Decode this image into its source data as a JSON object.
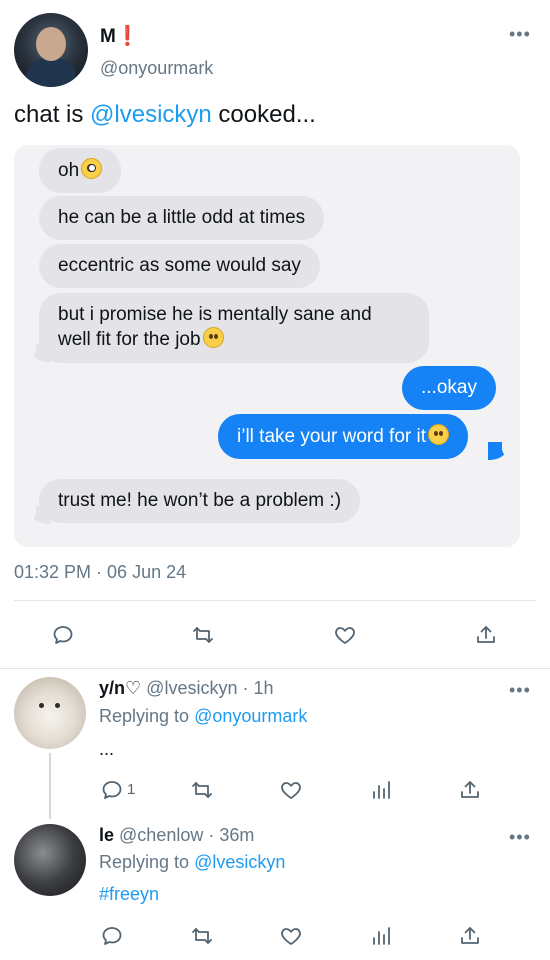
{
  "tweet": {
    "display_name": "M❗",
    "handle": "@onyourmark",
    "text_prefix": "chat is ",
    "text_mention": "@lvesickyn",
    "text_suffix": " cooked...",
    "timestamp": "01:32 PM · 06 Jun 24",
    "more_icon": "more-dots-icon"
  },
  "chat": {
    "messages": [
      {
        "side": "in",
        "text": "oh",
        "emoji": "nerd-face-emoji"
      },
      {
        "side": "in",
        "text": "he can be a little odd at times"
      },
      {
        "side": "in",
        "text": "eccentric as some would say"
      },
      {
        "side": "in",
        "line1": "but i promise he is mentally sane and",
        "line2": "well fit for the job",
        "emoji": "grinning-face-emoji"
      },
      {
        "side": "out",
        "text": "...okay"
      },
      {
        "side": "out",
        "text": "i’ll take your word for it",
        "emoji": "slightly-smiling-face-emoji"
      },
      {
        "side": "in",
        "text": "trust me! he won’t be a problem :)"
      }
    ],
    "colors": {
      "incoming": "#e3e3e8",
      "outgoing": "#1583f5",
      "card": "#f2f2f5"
    }
  },
  "actions": [
    "reply-icon",
    "retweet-icon",
    "like-icon",
    "share-icon"
  ],
  "replies": [
    {
      "display_name": "y/n♡",
      "handle": "@lvesickyn",
      "time": "1h",
      "replying_label": "Replying to ",
      "replying_to": "@onyourmark",
      "text": "...",
      "reply_count": "1",
      "actions": [
        "reply-icon",
        "retweet-icon",
        "like-icon",
        "views-icon",
        "share-icon"
      ]
    },
    {
      "display_name": "le",
      "handle": "@chenlow",
      "time": "36m",
      "replying_label": "Replying to ",
      "replying_to": "@lvesickyn",
      "text": "#freeyn",
      "actions": [
        "reply-icon",
        "retweet-icon",
        "like-icon",
        "views-icon",
        "share-icon"
      ]
    }
  ],
  "separator": " · ",
  "accent_color": "#1d9bf0"
}
